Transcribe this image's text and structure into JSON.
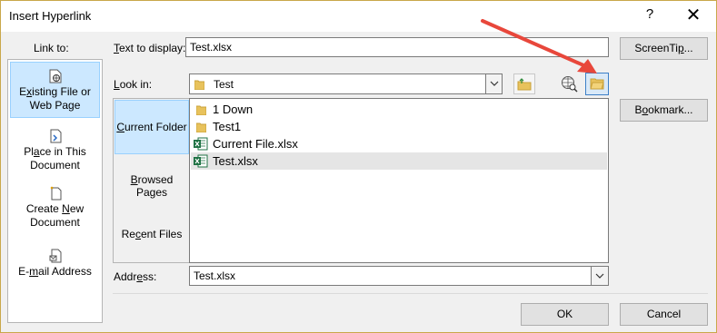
{
  "window": {
    "title": "Insert Hyperlink",
    "help": "?",
    "close": "✕"
  },
  "link_to": {
    "heading": "Link to:",
    "items": [
      {
        "label_pre": "",
        "label_u": "x",
        "label_post": "isting File or",
        "label2": "Web Page",
        "full": "Existing File or Web Page",
        "icon": "file-globe-icon",
        "selected": true
      },
      {
        "label_pre": "Pl",
        "label_u": "a",
        "label_post": "ce in This",
        "label2": "Document",
        "full": "Place in This Document",
        "icon": "document-arrow-icon"
      },
      {
        "label_pre": "Create ",
        "label_u": "N",
        "label_post": "ew",
        "label2": "Document",
        "full": "Create New Document",
        "icon": "new-document-icon"
      },
      {
        "label_pre": "E-",
        "label_u": "m",
        "label_post": "ail Address",
        "label2": "",
        "full": "E-mail Address",
        "icon": "email-icon"
      }
    ]
  },
  "text_to_display": {
    "label_u": "T",
    "label_rest": "ext to display:",
    "value": "Test.xlsx"
  },
  "screentip": {
    "label_pre": "ScreenTi",
    "label_u": "p",
    "label_post": "..."
  },
  "look_in": {
    "label_pre": "",
    "label_u": "L",
    "label_post": "ook in:",
    "value": "Test"
  },
  "nav": [
    {
      "label_pre": "",
      "label_u": "C",
      "label_post": "urrent Folder",
      "selected": true
    },
    {
      "label_pre": "",
      "label_u": "B",
      "label_post": "rowsed Pages"
    },
    {
      "label_pre": "Re",
      "label_u": "c",
      "label_post": "ent Files"
    }
  ],
  "files": [
    {
      "name": "1 Down",
      "type": "folder"
    },
    {
      "name": "Test1",
      "type": "folder"
    },
    {
      "name": "Current File.xlsx",
      "type": "excel"
    },
    {
      "name": "Test.xlsx",
      "type": "excel",
      "selected": true
    }
  ],
  "bookmark": {
    "label_pre": "B",
    "label_u": "o",
    "label_post": "okmark..."
  },
  "address": {
    "label_pre": "Addr",
    "label_u": "e",
    "label_post": "ss:",
    "value": "Test.xlsx"
  },
  "buttons": {
    "ok": "OK",
    "cancel": "Cancel"
  },
  "colors": {
    "accent_selection": "#cce8ff",
    "annotation_arrow": "#e8473b",
    "folder_yellow": "#e8c25c",
    "excel_green": "#1f7244"
  }
}
